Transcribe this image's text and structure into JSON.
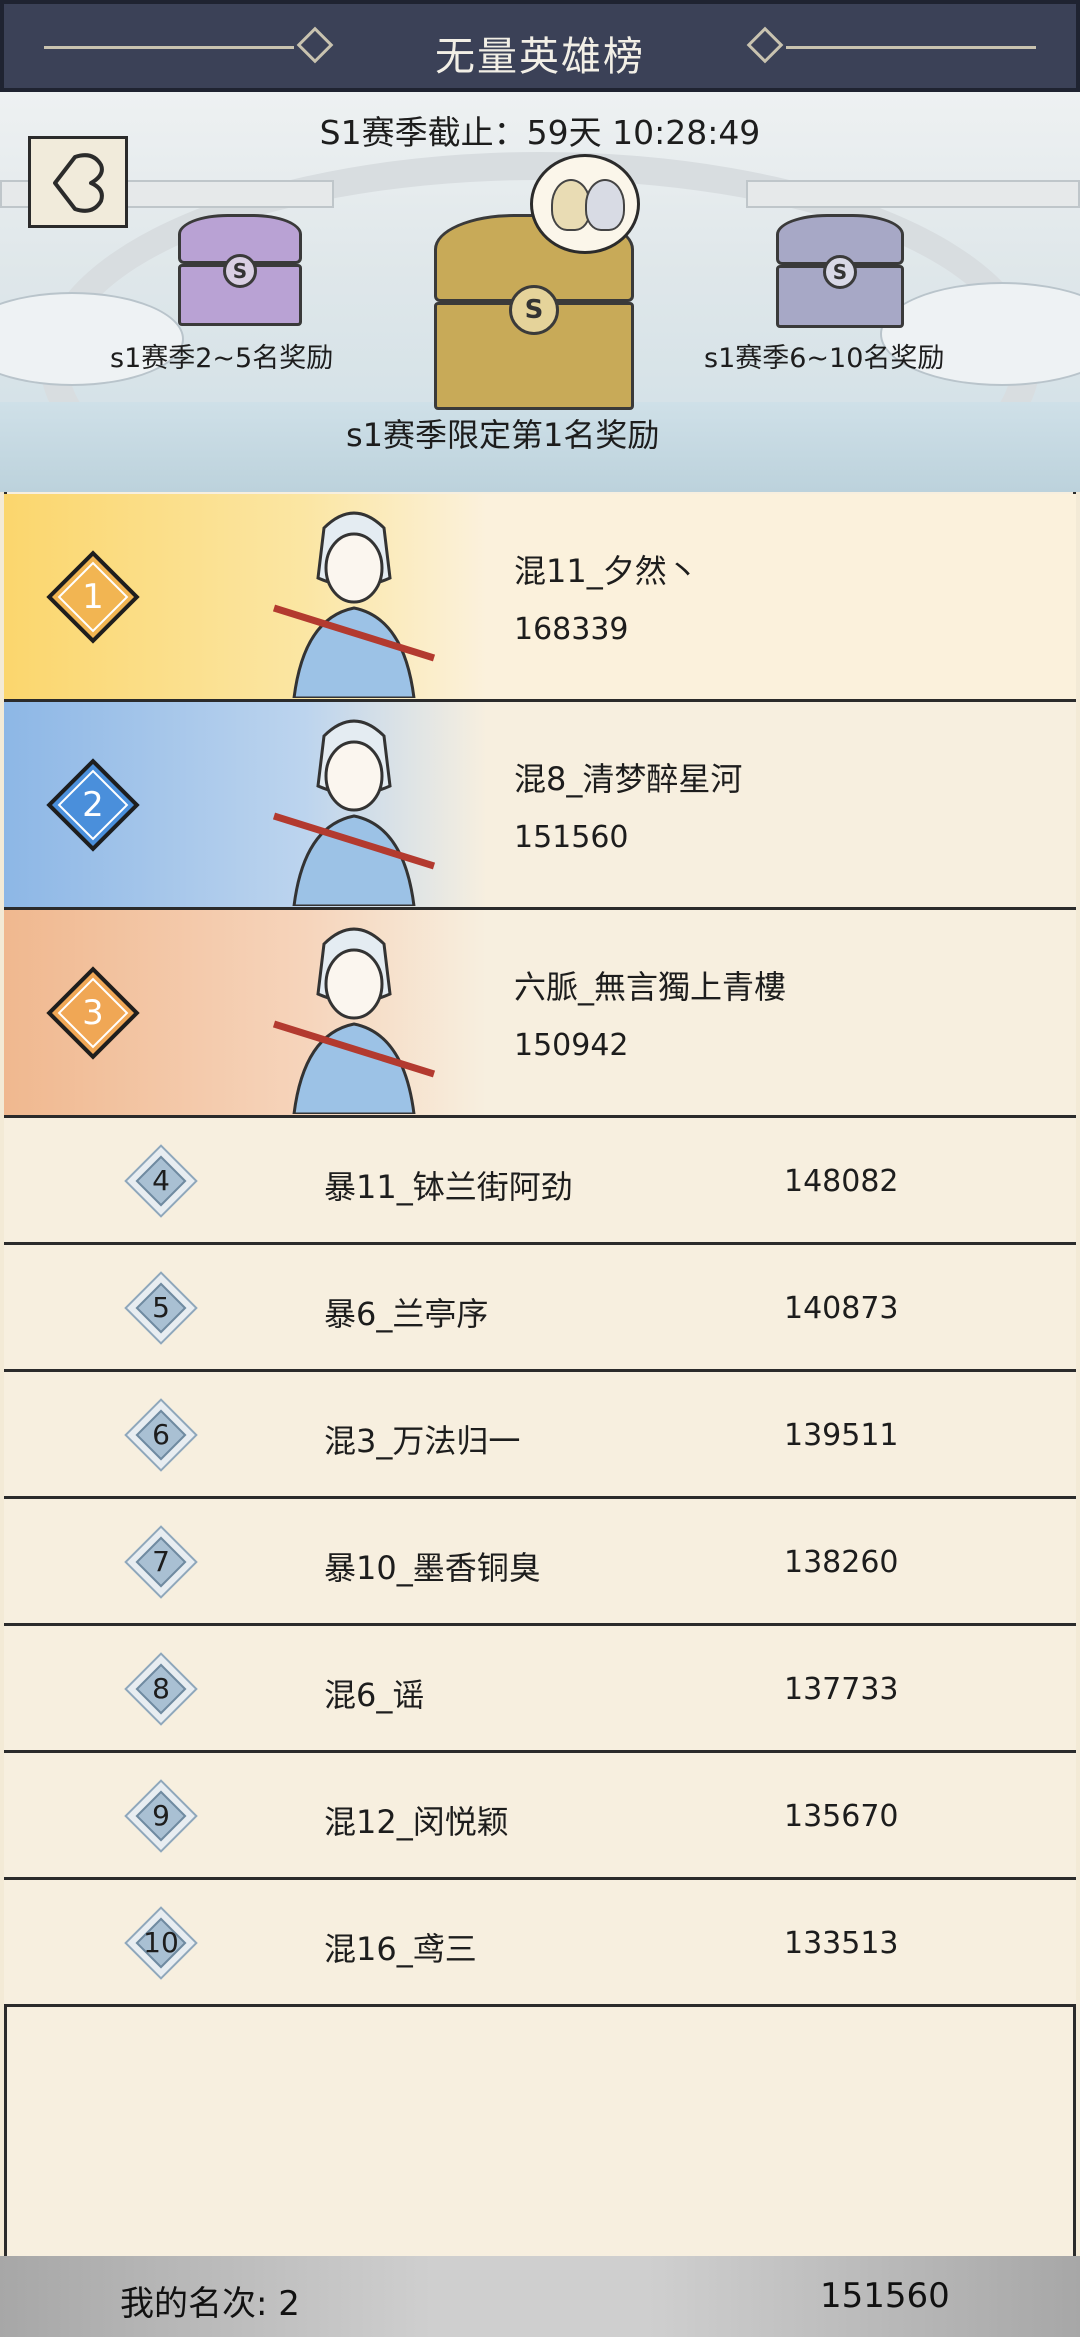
{
  "header": {
    "title": "无量英雄榜"
  },
  "season": {
    "countdown": "S1赛季截止：59天 10:28:49"
  },
  "rewards": {
    "left_label": "s1赛季2~5名奖励",
    "center_label": "s1赛季限定第1名奖励",
    "right_label": "s1赛季6~10名奖励",
    "chest_icon_letter": "S"
  },
  "top_three": [
    {
      "rank": "1",
      "name": "混11_夕然丶",
      "score": "168339"
    },
    {
      "rank": "2",
      "name": "混8_清梦醉星河",
      "score": "151560"
    },
    {
      "rank": "3",
      "name": "六脈_無言獨上青樓",
      "score": "150942"
    }
  ],
  "ranking": [
    {
      "rank": "4",
      "name": "暴11_钵兰街阿劲",
      "score": "148082"
    },
    {
      "rank": "5",
      "name": "暴6_兰亭序",
      "score": "140873"
    },
    {
      "rank": "6",
      "name": "混3_万法归一",
      "score": "139511"
    },
    {
      "rank": "7",
      "name": "暴10_墨香铜臭",
      "score": "138260"
    },
    {
      "rank": "8",
      "name": "混6_谣",
      "score": "137733"
    },
    {
      "rank": "9",
      "name": "混12_闵悦颖",
      "score": "135670"
    },
    {
      "rank": "10",
      "name": "混16_鸢三",
      "score": "133513"
    }
  ],
  "footer": {
    "my_rank_label": "我的名次:  2",
    "my_score": "151560"
  },
  "colors": {
    "title_bar": "#3b4157",
    "gold": "#f2b552",
    "blue": "#4a8fdb",
    "orange": "#f0a755",
    "paper": "#f7efdf"
  }
}
